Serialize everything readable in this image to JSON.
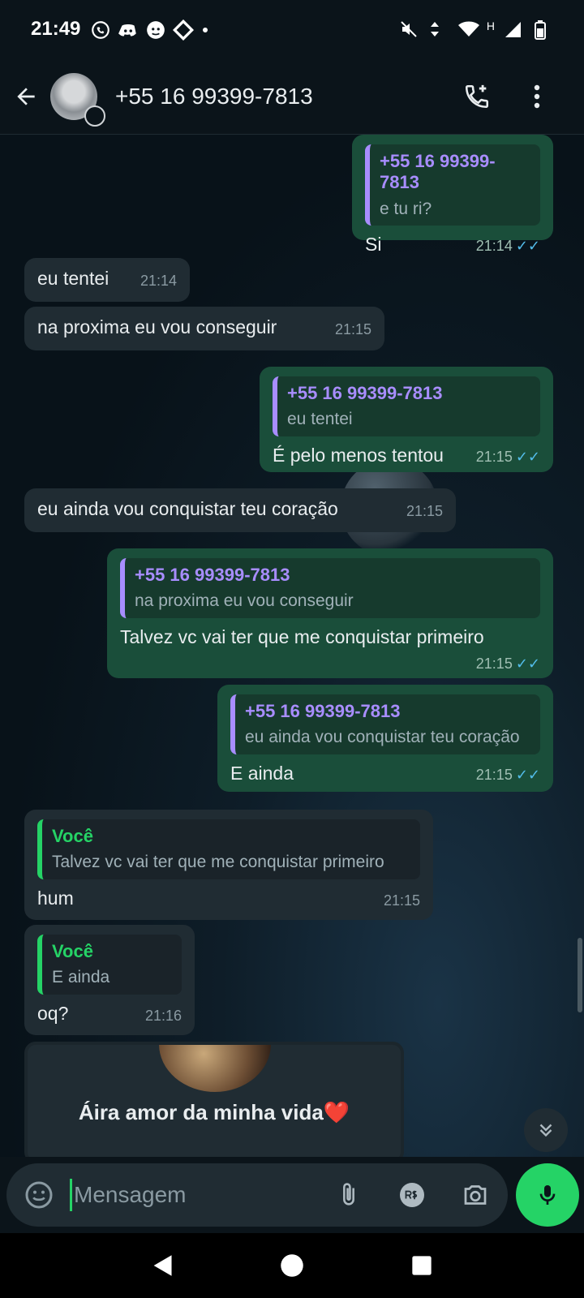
{
  "status": {
    "time": "21:49",
    "network": "H"
  },
  "header": {
    "contact_name": "+55 16 99399-7813"
  },
  "messages": [
    {
      "type": "outgoing",
      "quote_author": "+55 16 99399-7813",
      "quote_text": "e tu ri?",
      "text": "Si",
      "time": "21:14"
    },
    {
      "type": "incoming",
      "text": "eu tentei",
      "time": "21:14"
    },
    {
      "type": "incoming",
      "text": "na proxima eu vou conseguir",
      "time": "21:15"
    },
    {
      "type": "outgoing",
      "quote_author": "+55 16 99399-7813",
      "quote_text": "eu tentei",
      "text": "É pelo menos tentou",
      "time": "21:15"
    },
    {
      "type": "incoming",
      "text": "eu ainda vou conquistar teu coração",
      "time": "21:15"
    },
    {
      "type": "outgoing",
      "quote_author": "+55 16 99399-7813",
      "quote_text": "na proxima eu vou conseguir",
      "text": "Talvez vc vai ter que me conquistar primeiro",
      "time": "21:15"
    },
    {
      "type": "outgoing",
      "quote_author": "+55 16 99399-7813",
      "quote_text": "eu ainda vou conquistar teu coração",
      "text": "E ainda",
      "time": "21:15"
    },
    {
      "type": "incoming",
      "quote_author": "Você",
      "quote_text": "Talvez vc vai ter que me conquistar primeiro",
      "text": "hum",
      "time": "21:15"
    },
    {
      "type": "incoming",
      "quote_author": "Você",
      "quote_text": "E ainda",
      "text": "oq?",
      "time": "21:16"
    }
  ],
  "contact_card": {
    "name": "Áira amor da minha vida❤️"
  },
  "composer": {
    "placeholder": "Mensagem"
  },
  "icons": {
    "back": "arrow-left-icon",
    "add_call": "phone-plus-icon",
    "menu": "vertical-dots-icon",
    "emoji": "emoji-icon",
    "attach": "paperclip-icon",
    "payment": "payment-icon",
    "camera": "camera-icon",
    "mic": "microphone-icon",
    "scroll": "double-chevron-down-icon"
  },
  "colors": {
    "background": "#0b141a",
    "incoming_bubble": "#202c33",
    "outgoing_bubble": "#1a4e3a",
    "accent_green": "#25d366",
    "quote_purple": "#a88dff",
    "read_ticks": "#53bdeb"
  }
}
